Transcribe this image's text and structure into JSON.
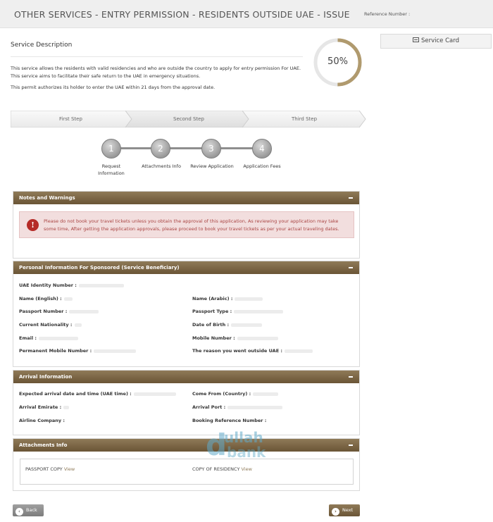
{
  "header": {
    "title": "OTHER SERVICES - ENTRY PERMISSION - RESIDENTS OUTSIDE UAE - ISSUE",
    "reference_label": "Reference Number :",
    "reference_value": ""
  },
  "service_card": {
    "label": "Service Card",
    "icon": "card-icon"
  },
  "service_description": {
    "title": "Service Description",
    "paragraph1": "This service allows the residents with valid residencies and who are outside the country to apply for entry permission For UAE. This service aims to facilitate their safe return to the UAE in emergency situations.",
    "paragraph2": "This permit authorizes its holder to enter the UAE within 21 days from the approval date."
  },
  "progress": {
    "value": 0.5,
    "label": "50%",
    "color": "#b09a6e"
  },
  "steps": [
    "First Step",
    "Second Step",
    "Third Step"
  ],
  "active_step": 1,
  "wizard": [
    {
      "number": "1",
      "label": "Request Information"
    },
    {
      "number": "2",
      "label": "Attachments Info"
    },
    {
      "number": "3",
      "label": "Review Application"
    },
    {
      "number": "4",
      "label": "Application Fees"
    }
  ],
  "notes": {
    "title": "Notes and Warnings",
    "warning": "Please do not book your travel tickets unless you obtain the approval of this application, As reviewing your application may take some time, After getting the application approvals, please proceed to book your travel tickets as per your actual traveling dates."
  },
  "personal": {
    "title": "Personal Information For Sponsored (Service Beneficiary)",
    "uae_id": "UAE Identity Number :",
    "name_en": "Name (English) :",
    "name_ar": "Name (Arabic) :",
    "passport_no": "Passport Number :",
    "passport_type": "Passport Type :",
    "nationality": "Current Nationality :",
    "dob": "Date of Birth :",
    "email": "Email :",
    "mobile": "Mobile Number :",
    "perm_mobile": "Permanent Mobile Number :",
    "reason": "The reason you went outside UAE :"
  },
  "arrival": {
    "title": "Arrival Information",
    "expected": "Expected arrival date and time (UAE time) :",
    "come_from": "Come From (Country) :",
    "emirate": "Arrival Emirate :",
    "port": "Arrival Port :",
    "airline": "Airline Company :",
    "booking": "Booking Reference Number :"
  },
  "attachments": {
    "title": "Attachments Info",
    "passport": "PASSPORT COPY",
    "residency": "COPY OF RESIDENCY",
    "view": "View"
  },
  "watermark": {
    "d": "d",
    "top": "ullah",
    "bottom": "bank"
  },
  "nav": {
    "back": "Back",
    "next": "Next"
  },
  "colors": {
    "brand": "#7d6847",
    "warning_bg": "#f2dede",
    "warning_text": "#a94442"
  }
}
